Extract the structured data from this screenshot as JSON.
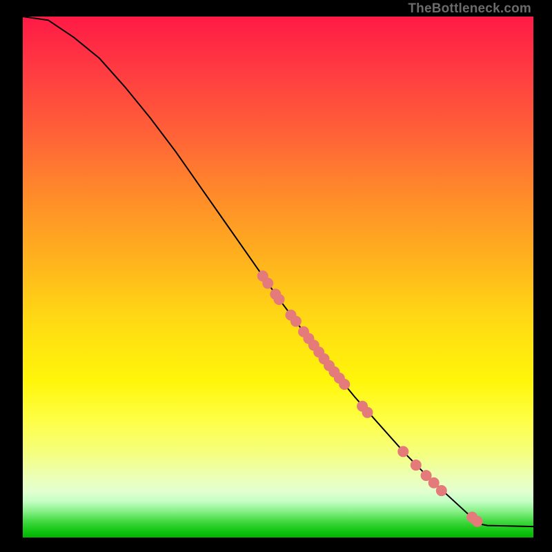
{
  "attribution": "TheBottleneck.com",
  "chart_data": {
    "type": "line",
    "title": "",
    "xlabel": "",
    "ylabel": "",
    "xlim": [
      0,
      100
    ],
    "ylim": [
      0,
      100
    ],
    "curve": [
      {
        "x": 0,
        "y": 100
      },
      {
        "x": 5,
        "y": 99.3
      },
      {
        "x": 10,
        "y": 96
      },
      {
        "x": 15,
        "y": 92
      },
      {
        "x": 20,
        "y": 86.5
      },
      {
        "x": 25,
        "y": 80.5
      },
      {
        "x": 30,
        "y": 74
      },
      {
        "x": 35,
        "y": 67
      },
      {
        "x": 40,
        "y": 60
      },
      {
        "x": 45,
        "y": 53
      },
      {
        "x": 50,
        "y": 46
      },
      {
        "x": 55,
        "y": 39.5
      },
      {
        "x": 60,
        "y": 33
      },
      {
        "x": 65,
        "y": 27
      },
      {
        "x": 70,
        "y": 21.5
      },
      {
        "x": 75,
        "y": 16
      },
      {
        "x": 80,
        "y": 11
      },
      {
        "x": 85,
        "y": 6.5
      },
      {
        "x": 88,
        "y": 3.8
      },
      {
        "x": 90,
        "y": 2.5
      },
      {
        "x": 91,
        "y": 2.3
      },
      {
        "x": 100,
        "y": 2.1
      }
    ],
    "dots": [
      {
        "x": 47,
        "y": 50.2
      },
      {
        "x": 48,
        "y": 48.8
      },
      {
        "x": 49.5,
        "y": 46.7
      },
      {
        "x": 50.2,
        "y": 45.7
      },
      {
        "x": 52.5,
        "y": 42.7
      },
      {
        "x": 53.5,
        "y": 41.5
      },
      {
        "x": 55,
        "y": 39.5
      },
      {
        "x": 56,
        "y": 38.2
      },
      {
        "x": 57,
        "y": 36.9
      },
      {
        "x": 58,
        "y": 35.6
      },
      {
        "x": 59,
        "y": 34.3
      },
      {
        "x": 60,
        "y": 33.0
      },
      {
        "x": 61,
        "y": 31.8
      },
      {
        "x": 62,
        "y": 30.6
      },
      {
        "x": 63,
        "y": 29.4
      },
      {
        "x": 66.5,
        "y": 25.2
      },
      {
        "x": 67.5,
        "y": 24.0
      },
      {
        "x": 74.5,
        "y": 16.5
      },
      {
        "x": 77,
        "y": 13.9
      },
      {
        "x": 79,
        "y": 11.9
      },
      {
        "x": 80.5,
        "y": 10.5
      },
      {
        "x": 82,
        "y": 9.0
      },
      {
        "x": 88,
        "y": 3.9
      },
      {
        "x": 89,
        "y": 3.1
      }
    ],
    "colors": {
      "line": "#000000",
      "dot": "#e47a7a"
    },
    "dot_radius_px": 8
  }
}
